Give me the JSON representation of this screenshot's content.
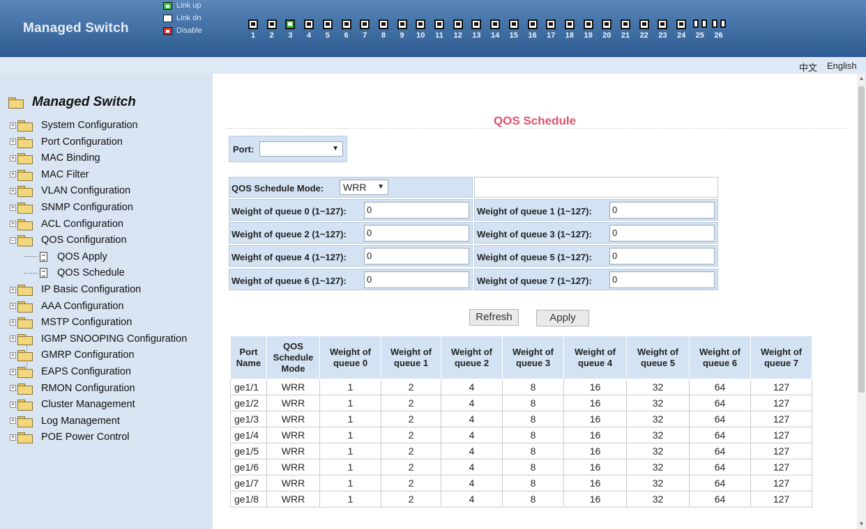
{
  "header": {
    "brand": "Managed Switch",
    "legend": [
      {
        "label": "Link up",
        "color": "#3fbf3f",
        "icon": "port-link-up-icon"
      },
      {
        "label": "Link dn",
        "color": "#ffffff",
        "icon": "port-link-down-icon"
      },
      {
        "label": "Disable",
        "color": "#e03030",
        "icon": "port-disabled-icon"
      }
    ],
    "ports": [
      {
        "num": "1",
        "state": "down"
      },
      {
        "num": "2",
        "state": "down"
      },
      {
        "num": "3",
        "state": "up"
      },
      {
        "num": "4",
        "state": "down"
      },
      {
        "num": "5",
        "state": "down"
      },
      {
        "num": "6",
        "state": "down"
      },
      {
        "num": "7",
        "state": "down"
      },
      {
        "num": "8",
        "state": "down"
      },
      {
        "num": "9",
        "state": "down"
      },
      {
        "num": "10",
        "state": "down"
      },
      {
        "num": "11",
        "state": "down"
      },
      {
        "num": "12",
        "state": "down"
      },
      {
        "num": "13",
        "state": "down"
      },
      {
        "num": "14",
        "state": "down"
      },
      {
        "num": "15",
        "state": "down"
      },
      {
        "num": "16",
        "state": "down"
      },
      {
        "num": "17",
        "state": "down"
      },
      {
        "num": "18",
        "state": "down"
      },
      {
        "num": "19",
        "state": "down"
      },
      {
        "num": "20",
        "state": "down"
      },
      {
        "num": "21",
        "state": "down"
      },
      {
        "num": "22",
        "state": "down"
      },
      {
        "num": "23",
        "state": "down"
      },
      {
        "num": "24",
        "state": "down"
      },
      {
        "num": "25",
        "state": "fiber"
      },
      {
        "num": "26",
        "state": "fiber"
      }
    ]
  },
  "lang": {
    "zh": "中文",
    "en": "English"
  },
  "sidebar": {
    "root": "Managed Switch",
    "items": [
      "System Configuration",
      "Port Configuration",
      "MAC Binding",
      "MAC Filter",
      "VLAN Configuration",
      "SNMP Configuration",
      "ACL Configuration",
      "QOS Configuration"
    ],
    "sub_items": [
      "QOS Apply",
      "QOS Schedule"
    ],
    "items_after": [
      "IP Basic Configuration",
      "AAA Configuration",
      "MSTP Configuration",
      "IGMP SNOOPING Configuration",
      "GMRP Configuration",
      "EAPS Configuration",
      "RMON Configuration",
      "Cluster Management",
      "Log Management",
      "POE Power Control"
    ]
  },
  "main": {
    "title": "QOS Schedule",
    "port_label": "Port:",
    "port_value": "",
    "mode_label": "QOS Schedule Mode:",
    "mode_value": "WRR",
    "weights": [
      {
        "label": "Weight of queue 0 (1~127):",
        "value": "0"
      },
      {
        "label": "Weight of queue 1 (1~127):",
        "value": "0"
      },
      {
        "label": "Weight of queue 2 (1~127):",
        "value": "0"
      },
      {
        "label": "Weight of queue 3 (1~127):",
        "value": "0"
      },
      {
        "label": "Weight of queue 4 (1~127):",
        "value": "0"
      },
      {
        "label": "Weight of queue 5 (1~127):",
        "value": "0"
      },
      {
        "label": "Weight of queue 6 (1~127):",
        "value": "0"
      },
      {
        "label": "Weight of queue 7 (1~127):",
        "value": "0"
      }
    ],
    "refresh_label": "Refresh",
    "apply_label": "Apply"
  },
  "table": {
    "headers": [
      "Port Name",
      "QOS Schedule Mode",
      "Weight of queue 0",
      "Weight of queue 1",
      "Weight of queue 2",
      "Weight of queue 3",
      "Weight of queue 4",
      "Weight of queue 5",
      "Weight of queue 6",
      "Weight of queue 7"
    ],
    "rows": [
      [
        "ge1/1",
        "WRR",
        "1",
        "2",
        "4",
        "8",
        "16",
        "32",
        "64",
        "127"
      ],
      [
        "ge1/2",
        "WRR",
        "1",
        "2",
        "4",
        "8",
        "16",
        "32",
        "64",
        "127"
      ],
      [
        "ge1/3",
        "WRR",
        "1",
        "2",
        "4",
        "8",
        "16",
        "32",
        "64",
        "127"
      ],
      [
        "ge1/4",
        "WRR",
        "1",
        "2",
        "4",
        "8",
        "16",
        "32",
        "64",
        "127"
      ],
      [
        "ge1/5",
        "WRR",
        "1",
        "2",
        "4",
        "8",
        "16",
        "32",
        "64",
        "127"
      ],
      [
        "ge1/6",
        "WRR",
        "1",
        "2",
        "4",
        "8",
        "16",
        "32",
        "64",
        "127"
      ],
      [
        "ge1/7",
        "WRR",
        "1",
        "2",
        "4",
        "8",
        "16",
        "32",
        "64",
        "127"
      ],
      [
        "ge1/8",
        "WRR",
        "1",
        "2",
        "4",
        "8",
        "16",
        "32",
        "64",
        "127"
      ]
    ]
  }
}
